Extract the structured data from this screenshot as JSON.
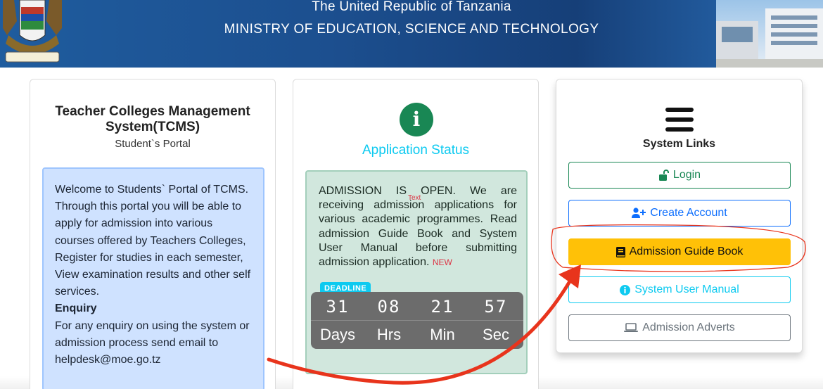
{
  "header": {
    "line1": "The United Republic of Tanzania",
    "line2": "MINISTRY OF EDUCATION, SCIENCE AND TECHNOLOGY"
  },
  "portal": {
    "title": "Teacher Colleges Management System(TCMS)",
    "subtitle": "Student`s Portal",
    "welcome": "Welcome to Students` Portal of TCMS. Through this portal you will be able to apply for admission into various courses offered by Teachers Colleges, Register for studies in each semester, View examination results and other self services.",
    "enquiry_heading": "Enquiry",
    "enquiry_text": "For any enquiry on using the system or admission process send email to helpdesk@moe.go.tz"
  },
  "status": {
    "heading": "Application Status",
    "notice": "ADMISSION IS OPEN. We are receiving admission applications for various academic programmes. Read admission Guide Book and System User Manual before submitting admission application.",
    "new_badge": "NEW",
    "text_mark": "Text",
    "deadline_label": "DEADLINE",
    "countdown": {
      "days": "31",
      "hours": "08",
      "minutes": "21",
      "seconds": "57",
      "days_label": "Days",
      "hours_label": "Hrs",
      "minutes_label": "Min",
      "seconds_label": "Sec"
    }
  },
  "links": {
    "heading": "System Links",
    "login": "Login",
    "create_account": "Create Account",
    "guide_book": "Admission Guide Book",
    "user_manual": "System User Manual",
    "adverts": "Admission Adverts"
  },
  "colors": {
    "header_bg": "#1c4f8f",
    "success": "#198754",
    "primary": "#0d6efd",
    "warning": "#ffc107",
    "info": "#0dcaf0",
    "secondary": "#6c757d",
    "annotation": "#e8341c"
  }
}
